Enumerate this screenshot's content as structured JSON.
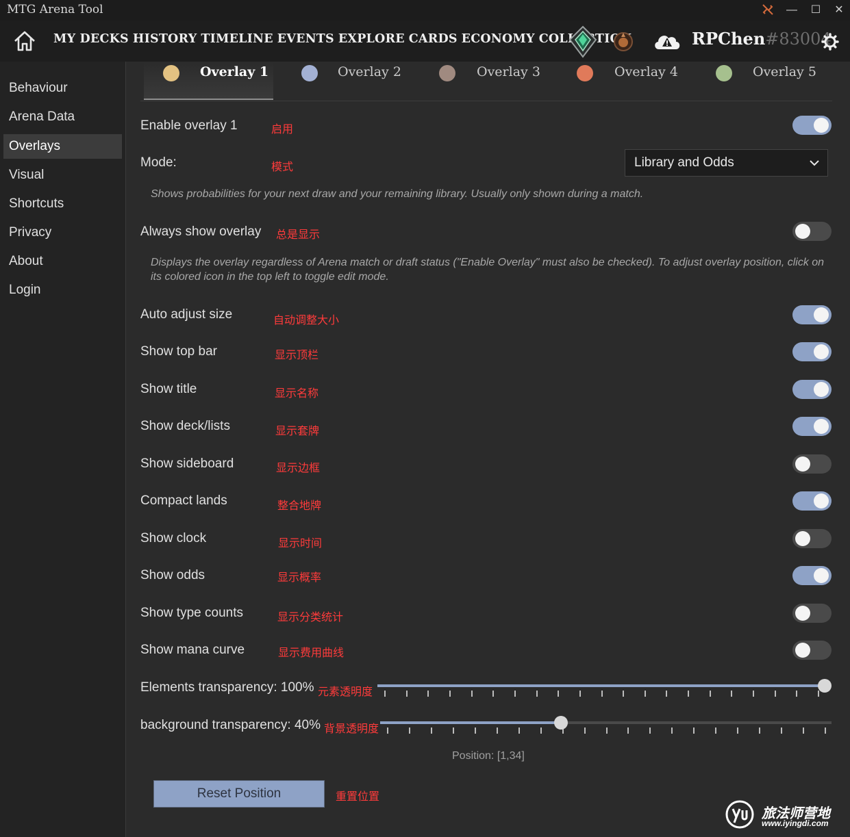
{
  "window": {
    "title": "MTG Arena Tool"
  },
  "nav": {
    "items": [
      "MY DECKS",
      "HISTORY",
      "TIMELINE",
      "EVENTS",
      "EXPLORE",
      "CARDS",
      "ECONOMY",
      "COLLECTION"
    ],
    "user_name": "RPChen",
    "user_tag": "#83004"
  },
  "sidebar": {
    "items": [
      "Behaviour",
      "Arena Data",
      "Overlays",
      "Visual",
      "Shortcuts",
      "Privacy",
      "About",
      "Login"
    ],
    "active": "Overlays"
  },
  "tabs": [
    {
      "label": "Overlay 1",
      "color": "#e3c282",
      "active": true
    },
    {
      "label": "Overlay 2",
      "color": "#a3b1d4",
      "active": false
    },
    {
      "label": "Overlay 3",
      "color": "#a08a80",
      "active": false
    },
    {
      "label": "Overlay 4",
      "color": "#e07a5a",
      "active": false
    },
    {
      "label": "Overlay 5",
      "color": "#a6c08e",
      "active": false
    }
  ],
  "settings": {
    "enable": {
      "label": "Enable overlay 1",
      "cn": "启用",
      "on": true
    },
    "mode": {
      "label": "Mode:",
      "cn": "模式",
      "value": "Library and Odds"
    },
    "mode_desc": "Shows probabilities for your next draw and your remaining library. Usually only shown during a match.",
    "always": {
      "label": "Always show overlay",
      "cn": "总是显示",
      "on": false
    },
    "always_desc": "Displays the overlay regardless of Arena match or draft status (\"Enable Overlay\" must also be checked). To adjust overlay position, click on its colored icon in the top left to toggle edit mode.",
    "toggles": [
      {
        "label": "Auto adjust size",
        "cn": "自动调整大小",
        "on": true
      },
      {
        "label": "Show top bar",
        "cn": "显示顶栏",
        "on": true
      },
      {
        "label": "Show title",
        "cn": "显示名称",
        "on": true
      },
      {
        "label": "Show deck/lists",
        "cn": "显示套牌",
        "on": true
      },
      {
        "label": "Show sideboard",
        "cn": "显示边框",
        "on": false
      },
      {
        "label": "Compact lands",
        "cn": "整合地牌",
        "on": true
      },
      {
        "label": "Show clock",
        "cn": "显示时间",
        "on": false
      },
      {
        "label": "Show odds",
        "cn": "显示概率",
        "on": true
      },
      {
        "label": "Show type counts",
        "cn": "显示分类统计",
        "on": false
      },
      {
        "label": "Show mana curve",
        "cn": "显示费用曲线",
        "on": false
      }
    ],
    "elements_transparency": {
      "label": "Elements transparency: 100%",
      "cn": "元素透明度",
      "value": 1.0
    },
    "background_transparency": {
      "label": "background transparency: 40%",
      "cn": "背景透明度",
      "value": 0.4
    },
    "position": "Position: [1,34]",
    "reset": {
      "label": "Reset Position",
      "cn": "重置位置"
    }
  },
  "watermark": {
    "title": "旅法师营地",
    "url": "www.iyingdi.com"
  }
}
